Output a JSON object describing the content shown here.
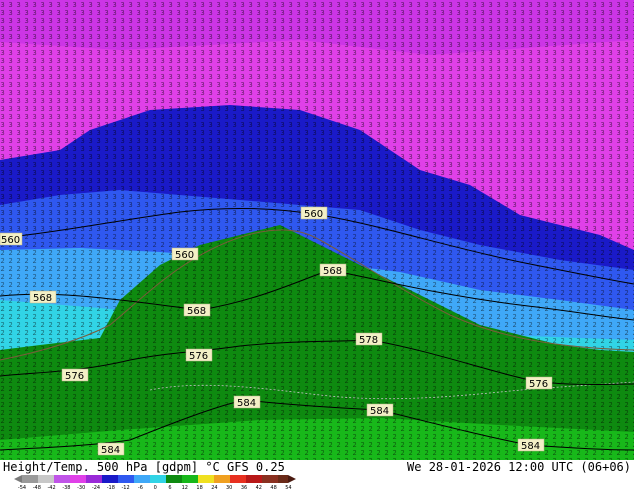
{
  "title": "Height/Temp. 500 hPa [gdpm] °C GFS 0.25",
  "title_left": "Height/Temp. 500 hPa [gdpm]",
  "title_unit": "°C",
  "title_model": "GFS 0.25",
  "valid_time": "We 28-01-2026 12:00 UTC (06+06)",
  "colorbar_ticks": [
    "-54",
    "-48",
    "-42",
    "-38",
    "-30",
    "-24",
    "-18",
    "-12",
    "-6",
    "0",
    "6",
    "12",
    "18",
    "24",
    "30",
    "36",
    "42",
    "48",
    "54"
  ],
  "contour_labels": [
    {
      "text": "560"
    },
    {
      "text": "560"
    },
    {
      "text": "560"
    },
    {
      "text": "568"
    },
    {
      "text": "568"
    },
    {
      "text": "568"
    },
    {
      "text": "576"
    },
    {
      "text": "576"
    },
    {
      "text": "578"
    },
    {
      "text": "576"
    },
    {
      "text": "584"
    },
    {
      "text": "584"
    },
    {
      "text": "584"
    },
    {
      "text": "584"
    }
  ],
  "colors": {
    "magenta": "#e040e8",
    "purple": "#9a2ad8",
    "blue_dark": "#1a1ac8",
    "blue": "#2f58f0",
    "sky": "#3fa8f8",
    "cyan": "#31d4e6",
    "green": "#0e8a10",
    "green_light": "#18b81a"
  }
}
